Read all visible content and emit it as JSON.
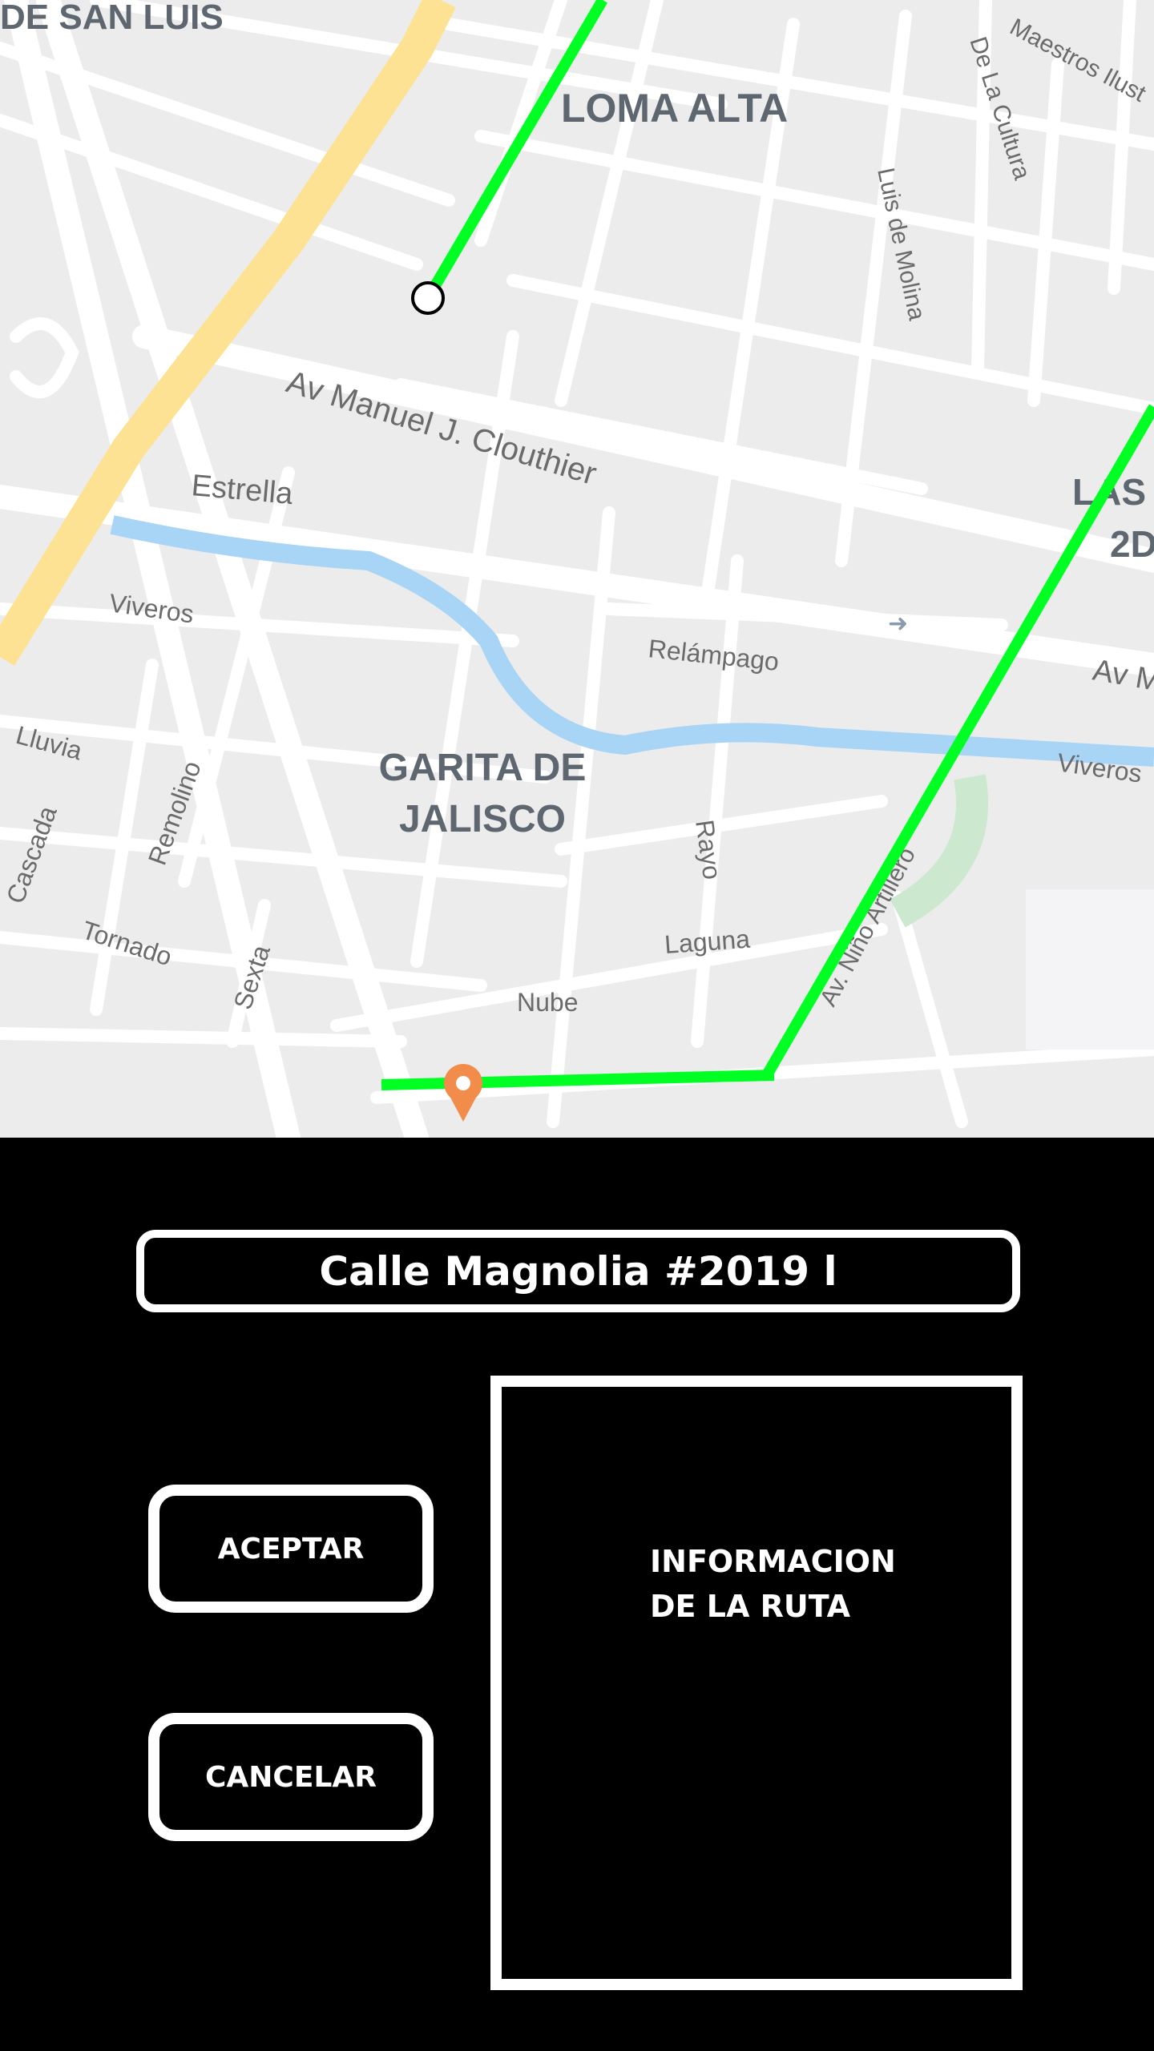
{
  "map": {
    "areas": {
      "san_luis": "DE SAN LUIS",
      "loma_alta": "LOMA ALTA",
      "garita_line1": "GARITA DE",
      "garita_line2": "JALISCO",
      "las_line1": "LAS",
      "las_line2": "2D"
    },
    "streets": {
      "clouthier": "Av Manuel J. Clouthier",
      "estrella": "Estrella",
      "viveros_left": "Viveros",
      "viveros_right": "Viveros",
      "relampago": "Relámpago",
      "av_m": "Av M",
      "lluvia": "Lluvia",
      "cascada": "Cascada",
      "remolino": "Remolino",
      "tornado": "Tornado",
      "sexta": "Sexta",
      "nube": "Nube",
      "laguna": "Laguna",
      "rayo": "Rayo",
      "nino_artillero": "Av. Niño Artillero",
      "luis_de_molina": "Luis de Molina",
      "de_la_cultura": "De La Cultura",
      "maestros": "Maestros Ilust"
    },
    "route_color": "#00ff22",
    "water_color": "#a8d4f5",
    "highway_color": "#fde293",
    "marker_color": "#f28c4b"
  },
  "panel": {
    "address": "Calle Magnolia #2019 l",
    "accept_label": "ACEPTAR",
    "cancel_label": "CANCELAR",
    "info_line1": "INFORMACION",
    "info_line2": "DE LA RUTA"
  }
}
